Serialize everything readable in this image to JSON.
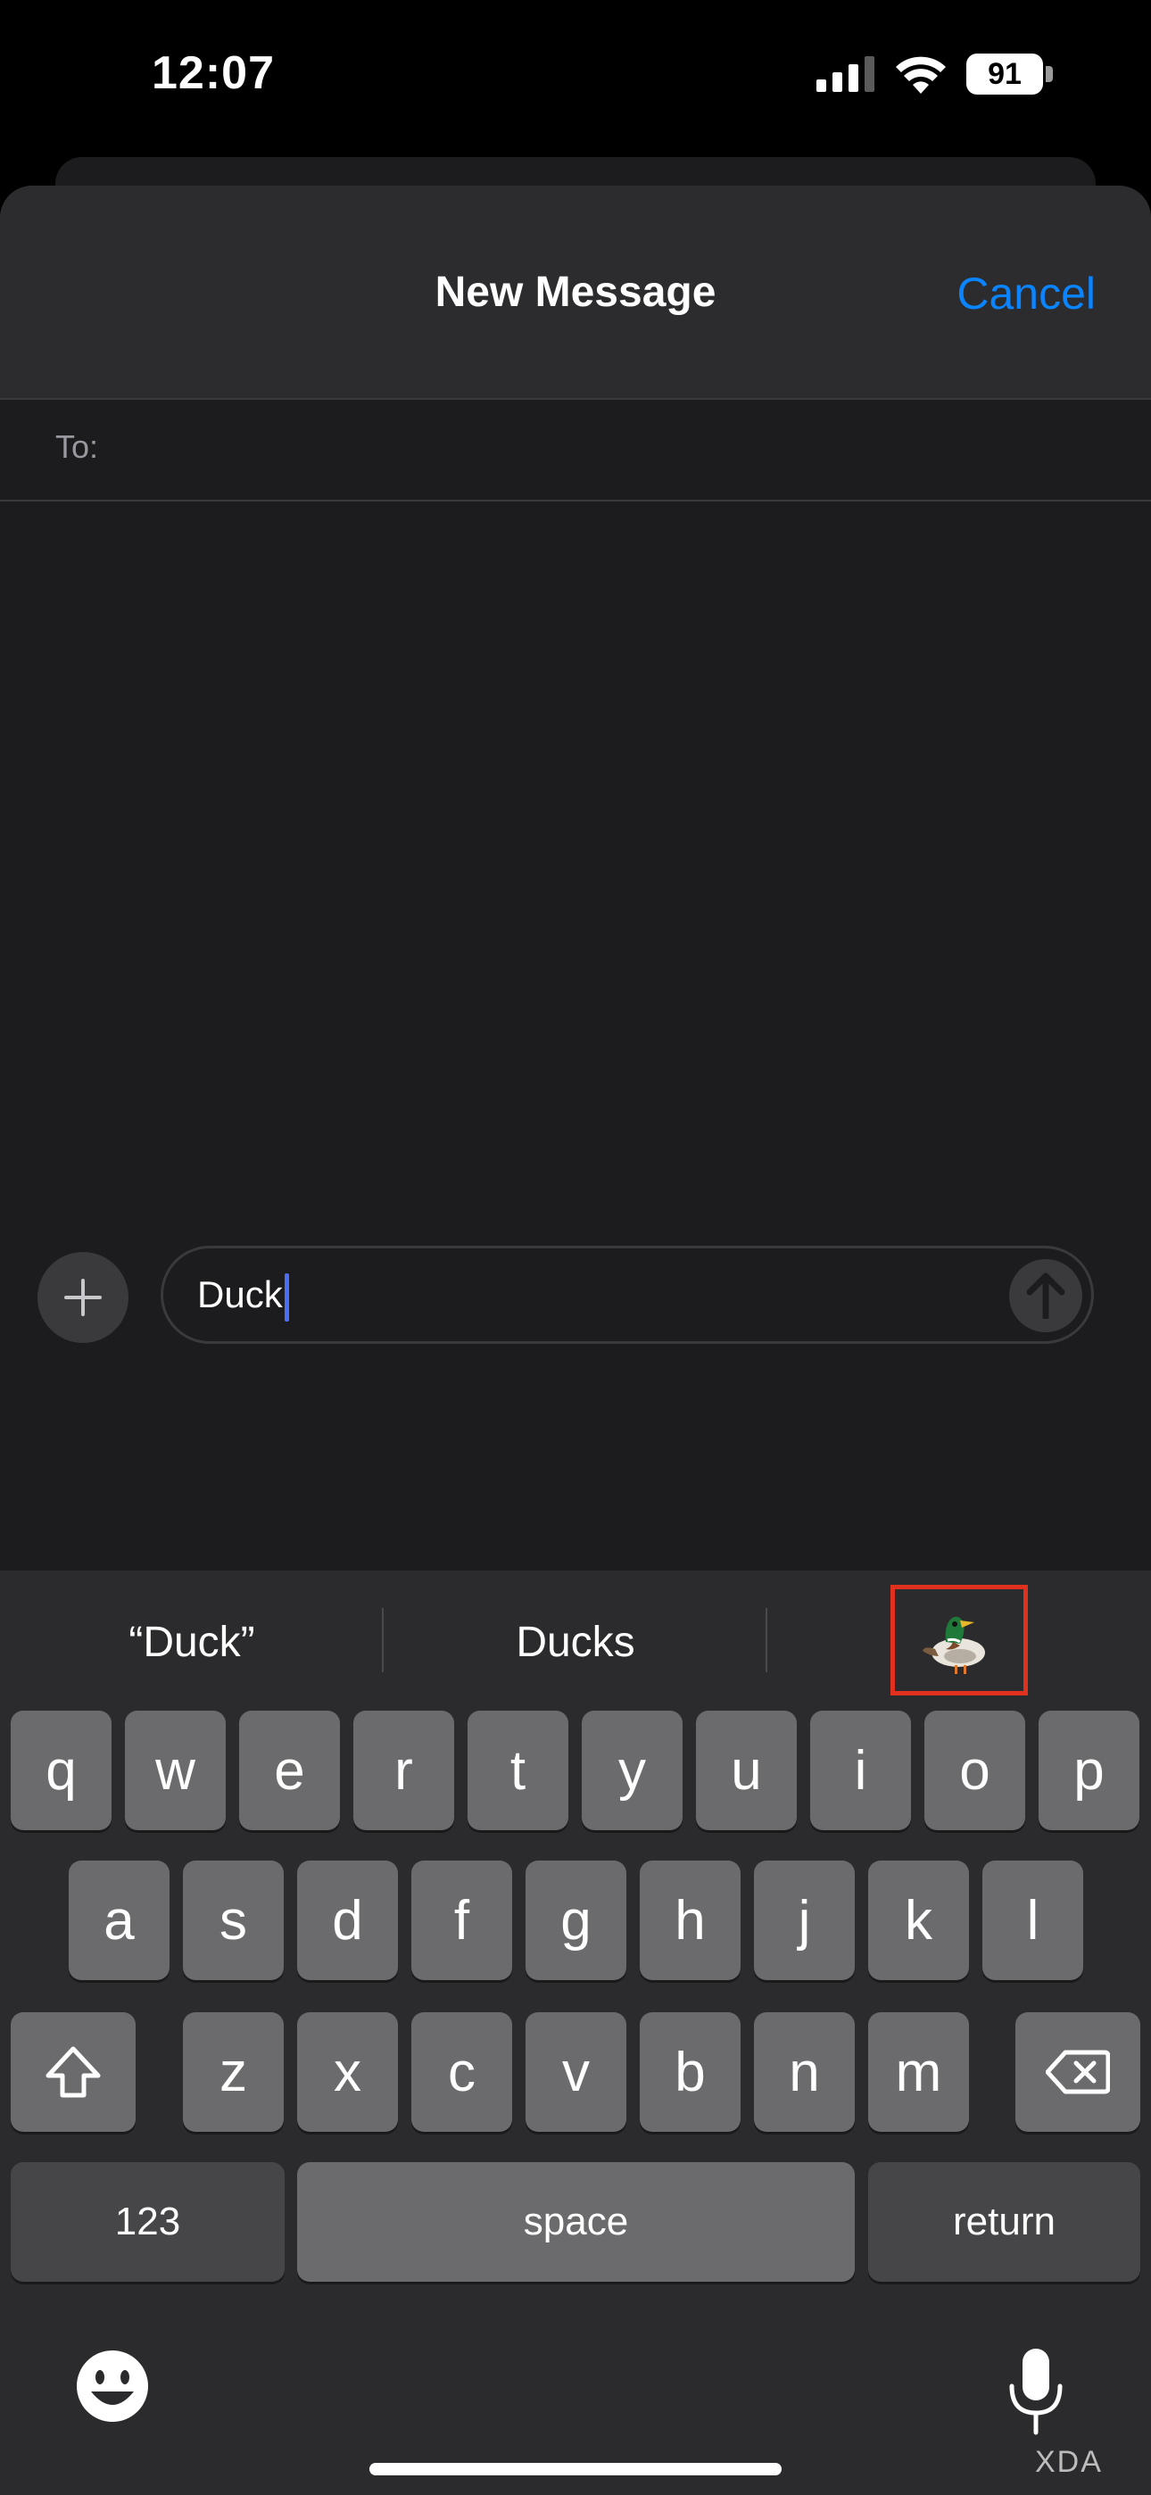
{
  "status_bar": {
    "time": "12:07",
    "battery": "91"
  },
  "header": {
    "title": "New Message",
    "cancel_label": "Cancel"
  },
  "to_field": {
    "label": "To:"
  },
  "compose": {
    "text": "Duck"
  },
  "predictions": {
    "first": "“Duck”",
    "second": "Ducks",
    "third_emoji": "duck-emoji"
  },
  "keyboard": {
    "row1": [
      "q",
      "w",
      "e",
      "r",
      "t",
      "y",
      "u",
      "i",
      "o",
      "p"
    ],
    "row2": [
      "a",
      "s",
      "d",
      "f",
      "g",
      "h",
      "j",
      "k",
      "l"
    ],
    "row3": [
      "z",
      "x",
      "c",
      "v",
      "b",
      "n",
      "m"
    ],
    "numbers_label": "123",
    "space_label": "space",
    "return_label": "return"
  },
  "watermark": "XDA",
  "colors": {
    "accent": "#0a84ff",
    "highlight_box": "#e0301e",
    "caret": "#4c6ef5"
  }
}
